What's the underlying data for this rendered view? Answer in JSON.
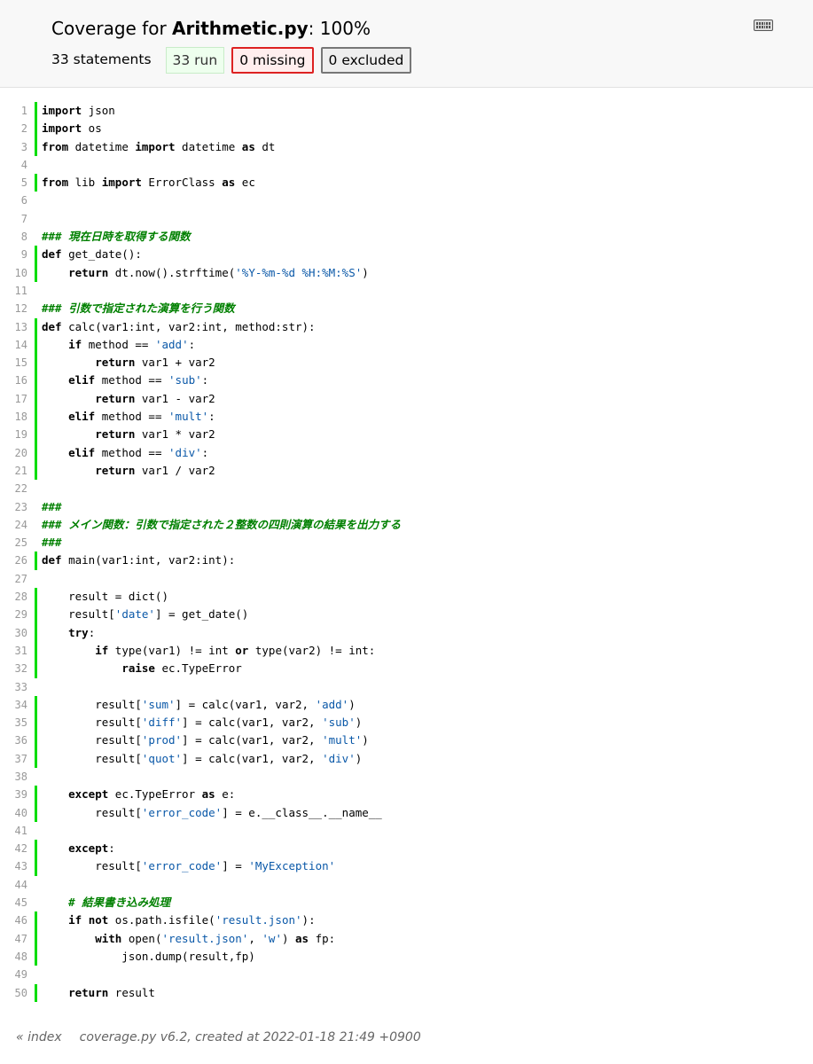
{
  "header": {
    "title_prefix": "Coverage for ",
    "file_name": "Arithmetic.py",
    "title_suffix": ": 100%",
    "statements": "33 statements",
    "run": "33 run",
    "missing": "0 missing",
    "excluded": "0 excluded",
    "keyboard_icon": "keyboard-icon"
  },
  "source": [
    {
      "n": "1",
      "run": true,
      "tokens": [
        [
          "kw",
          "import"
        ],
        [
          "p",
          " json"
        ]
      ]
    },
    {
      "n": "2",
      "run": true,
      "tokens": [
        [
          "kw",
          "import"
        ],
        [
          "p",
          " os"
        ]
      ]
    },
    {
      "n": "3",
      "run": true,
      "tokens": [
        [
          "kw",
          "from"
        ],
        [
          "p",
          " datetime "
        ],
        [
          "kw",
          "import"
        ],
        [
          "p",
          " datetime "
        ],
        [
          "kw",
          "as"
        ],
        [
          "p",
          " dt"
        ]
      ]
    },
    {
      "n": "4",
      "run": false,
      "tokens": []
    },
    {
      "n": "5",
      "run": true,
      "tokens": [
        [
          "kw",
          "from"
        ],
        [
          "p",
          " lib "
        ],
        [
          "kw",
          "import"
        ],
        [
          "p",
          " ErrorClass "
        ],
        [
          "kw",
          "as"
        ],
        [
          "p",
          " ec"
        ]
      ]
    },
    {
      "n": "6",
      "run": false,
      "tokens": []
    },
    {
      "n": "7",
      "run": false,
      "tokens": []
    },
    {
      "n": "8",
      "run": false,
      "tokens": [
        [
          "com",
          "### 現在日時を取得する関数"
        ]
      ]
    },
    {
      "n": "9",
      "run": true,
      "tokens": [
        [
          "kw",
          "def"
        ],
        [
          "p",
          " get_date():"
        ]
      ]
    },
    {
      "n": "10",
      "run": true,
      "tokens": [
        [
          "p",
          "    "
        ],
        [
          "kw",
          "return"
        ],
        [
          "p",
          " dt.now().strftime("
        ],
        [
          "str",
          "'%Y-%m-%d %H:%M:%S'"
        ],
        [
          "p",
          ")"
        ]
      ]
    },
    {
      "n": "11",
      "run": false,
      "tokens": []
    },
    {
      "n": "12",
      "run": false,
      "tokens": [
        [
          "com",
          "### 引数で指定された演算を行う関数"
        ]
      ]
    },
    {
      "n": "13",
      "run": true,
      "tokens": [
        [
          "kw",
          "def"
        ],
        [
          "p",
          " calc(var1:int, var2:int, method:str):"
        ]
      ]
    },
    {
      "n": "14",
      "run": true,
      "tokens": [
        [
          "p",
          "    "
        ],
        [
          "kw",
          "if"
        ],
        [
          "p",
          " method == "
        ],
        [
          "str",
          "'add'"
        ],
        [
          "p",
          ":"
        ]
      ]
    },
    {
      "n": "15",
      "run": true,
      "tokens": [
        [
          "p",
          "        "
        ],
        [
          "kw",
          "return"
        ],
        [
          "p",
          " var1 + var2"
        ]
      ]
    },
    {
      "n": "16",
      "run": true,
      "tokens": [
        [
          "p",
          "    "
        ],
        [
          "kw",
          "elif"
        ],
        [
          "p",
          " method == "
        ],
        [
          "str",
          "'sub'"
        ],
        [
          "p",
          ":"
        ]
      ]
    },
    {
      "n": "17",
      "run": true,
      "tokens": [
        [
          "p",
          "        "
        ],
        [
          "kw",
          "return"
        ],
        [
          "p",
          " var1 - var2"
        ]
      ]
    },
    {
      "n": "18",
      "run": true,
      "tokens": [
        [
          "p",
          "    "
        ],
        [
          "kw",
          "elif"
        ],
        [
          "p",
          " method == "
        ],
        [
          "str",
          "'mult'"
        ],
        [
          "p",
          ":"
        ]
      ]
    },
    {
      "n": "19",
      "run": true,
      "tokens": [
        [
          "p",
          "        "
        ],
        [
          "kw",
          "return"
        ],
        [
          "p",
          " var1 * var2"
        ]
      ]
    },
    {
      "n": "20",
      "run": true,
      "tokens": [
        [
          "p",
          "    "
        ],
        [
          "kw",
          "elif"
        ],
        [
          "p",
          " method == "
        ],
        [
          "str",
          "'div'"
        ],
        [
          "p",
          ":"
        ]
      ]
    },
    {
      "n": "21",
      "run": true,
      "tokens": [
        [
          "p",
          "        "
        ],
        [
          "kw",
          "return"
        ],
        [
          "p",
          " var1 / var2"
        ]
      ]
    },
    {
      "n": "22",
      "run": false,
      "tokens": []
    },
    {
      "n": "23",
      "run": false,
      "tokens": [
        [
          "com",
          "###"
        ]
      ]
    },
    {
      "n": "24",
      "run": false,
      "tokens": [
        [
          "com",
          "### メイン関数：引数で指定された２整数の四則演算の結果を出力する"
        ]
      ]
    },
    {
      "n": "25",
      "run": false,
      "tokens": [
        [
          "com",
          "###"
        ]
      ]
    },
    {
      "n": "26",
      "run": true,
      "tokens": [
        [
          "kw",
          "def"
        ],
        [
          "p",
          " main(var1:int, var2:int):"
        ]
      ]
    },
    {
      "n": "27",
      "run": false,
      "tokens": []
    },
    {
      "n": "28",
      "run": true,
      "tokens": [
        [
          "p",
          "    result = dict()"
        ]
      ]
    },
    {
      "n": "29",
      "run": true,
      "tokens": [
        [
          "p",
          "    result["
        ],
        [
          "str",
          "'date'"
        ],
        [
          "p",
          "] = get_date()"
        ]
      ]
    },
    {
      "n": "30",
      "run": true,
      "tokens": [
        [
          "p",
          "    "
        ],
        [
          "kw",
          "try"
        ],
        [
          "p",
          ":"
        ]
      ]
    },
    {
      "n": "31",
      "run": true,
      "tokens": [
        [
          "p",
          "        "
        ],
        [
          "kw",
          "if"
        ],
        [
          "p",
          " type(var1) != int "
        ],
        [
          "kw",
          "or"
        ],
        [
          "p",
          " type(var2) != int:"
        ]
      ]
    },
    {
      "n": "32",
      "run": true,
      "tokens": [
        [
          "p",
          "            "
        ],
        [
          "kw",
          "raise"
        ],
        [
          "p",
          " ec.TypeError"
        ]
      ]
    },
    {
      "n": "33",
      "run": false,
      "tokens": []
    },
    {
      "n": "34",
      "run": true,
      "tokens": [
        [
          "p",
          "        result["
        ],
        [
          "str",
          "'sum'"
        ],
        [
          "p",
          "] = calc(var1, var2, "
        ],
        [
          "str",
          "'add'"
        ],
        [
          "p",
          ")"
        ]
      ]
    },
    {
      "n": "35",
      "run": true,
      "tokens": [
        [
          "p",
          "        result["
        ],
        [
          "str",
          "'diff'"
        ],
        [
          "p",
          "] = calc(var1, var2, "
        ],
        [
          "str",
          "'sub'"
        ],
        [
          "p",
          ")"
        ]
      ]
    },
    {
      "n": "36",
      "run": true,
      "tokens": [
        [
          "p",
          "        result["
        ],
        [
          "str",
          "'prod'"
        ],
        [
          "p",
          "] = calc(var1, var2, "
        ],
        [
          "str",
          "'mult'"
        ],
        [
          "p",
          ")"
        ]
      ]
    },
    {
      "n": "37",
      "run": true,
      "tokens": [
        [
          "p",
          "        result["
        ],
        [
          "str",
          "'quot'"
        ],
        [
          "p",
          "] = calc(var1, var2, "
        ],
        [
          "str",
          "'div'"
        ],
        [
          "p",
          ")"
        ]
      ]
    },
    {
      "n": "38",
      "run": false,
      "tokens": []
    },
    {
      "n": "39",
      "run": true,
      "tokens": [
        [
          "p",
          "    "
        ],
        [
          "kw",
          "except"
        ],
        [
          "p",
          " ec.TypeError "
        ],
        [
          "kw",
          "as"
        ],
        [
          "p",
          " e:"
        ]
      ]
    },
    {
      "n": "40",
      "run": true,
      "tokens": [
        [
          "p",
          "        result["
        ],
        [
          "str",
          "'error_code'"
        ],
        [
          "p",
          "] = e.__class__.__name__"
        ]
      ]
    },
    {
      "n": "41",
      "run": false,
      "tokens": []
    },
    {
      "n": "42",
      "run": true,
      "tokens": [
        [
          "p",
          "    "
        ],
        [
          "kw",
          "except"
        ],
        [
          "p",
          ":"
        ]
      ]
    },
    {
      "n": "43",
      "run": true,
      "tokens": [
        [
          "p",
          "        result["
        ],
        [
          "str",
          "'error_code'"
        ],
        [
          "p",
          "] = "
        ],
        [
          "str",
          "'MyException'"
        ]
      ]
    },
    {
      "n": "44",
      "run": false,
      "tokens": []
    },
    {
      "n": "45",
      "run": false,
      "tokens": [
        [
          "p",
          "    "
        ],
        [
          "com",
          "# 結果書き込み処理"
        ]
      ]
    },
    {
      "n": "46",
      "run": true,
      "tokens": [
        [
          "p",
          "    "
        ],
        [
          "kw",
          "if"
        ],
        [
          "p",
          " "
        ],
        [
          "kw",
          "not"
        ],
        [
          "p",
          " os.path.isfile("
        ],
        [
          "str",
          "'result.json'"
        ],
        [
          "p",
          "):"
        ]
      ]
    },
    {
      "n": "47",
      "run": true,
      "tokens": [
        [
          "p",
          "        "
        ],
        [
          "kw",
          "with"
        ],
        [
          "p",
          " open("
        ],
        [
          "str",
          "'result.json'"
        ],
        [
          "p",
          ", "
        ],
        [
          "str",
          "'w'"
        ],
        [
          "p",
          ") "
        ],
        [
          "kw",
          "as"
        ],
        [
          "p",
          " fp:"
        ]
      ]
    },
    {
      "n": "48",
      "run": true,
      "tokens": [
        [
          "p",
          "            json.dump(result,fp)"
        ]
      ]
    },
    {
      "n": "49",
      "run": false,
      "tokens": []
    },
    {
      "n": "50",
      "run": true,
      "tokens": [
        [
          "p",
          "    "
        ],
        [
          "kw",
          "return"
        ],
        [
          "p",
          " result"
        ]
      ]
    }
  ],
  "footer": {
    "index_link": "« index",
    "created": "coverage.py v6.2, created at 2022-01-18 21:49 +0900"
  },
  "colors": {
    "run_marker": "#00dd00",
    "missing_border": "#dd2222",
    "string": "#0a58a8",
    "comment": "#008000"
  }
}
